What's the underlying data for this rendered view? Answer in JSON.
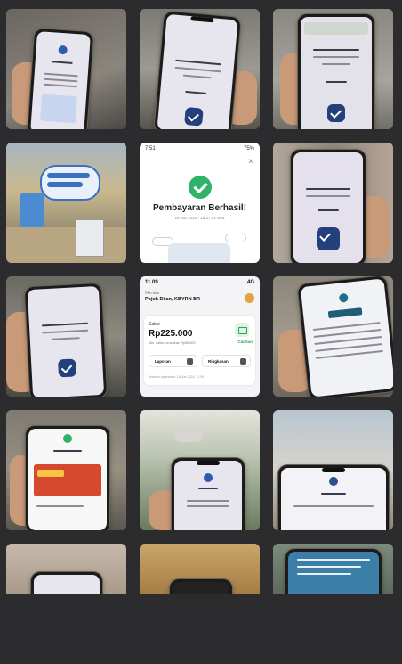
{
  "gallery": {
    "tiles": [
      {
        "kind": "photo",
        "subject": "phone-payment-app"
      },
      {
        "kind": "photo",
        "subject": "phone-payment-confirm"
      },
      {
        "kind": "photo",
        "subject": "phone-payment-notification"
      },
      {
        "kind": "photo",
        "subject": "event-booth"
      },
      {
        "kind": "screenshot",
        "subject": "payment-success"
      },
      {
        "kind": "photo",
        "subject": "phone-payment-success"
      },
      {
        "kind": "photo",
        "subject": "phone-payment-success"
      },
      {
        "kind": "screenshot",
        "subject": "merchant-balance"
      },
      {
        "kind": "photo",
        "subject": "phone-transaction-detail"
      },
      {
        "kind": "photo",
        "subject": "phone-amount-promo"
      },
      {
        "kind": "photo",
        "subject": "phone-payment-amount"
      },
      {
        "kind": "photo",
        "subject": "phone-payment-success"
      },
      {
        "kind": "photo",
        "subject": "phone-partial"
      },
      {
        "kind": "photo",
        "subject": "phone-partial"
      },
      {
        "kind": "photo",
        "subject": "phone-partial"
      }
    ]
  },
  "success_screen": {
    "status_time": "7:51",
    "status_battery": "75%",
    "title": "Pembayaran Berhasil!",
    "date": "16 Jun 2020 · 15:37:51 WIB"
  },
  "balance_screen": {
    "status_time": "11.09",
    "status_network": "4G",
    "merchant_label": "Pilih toko",
    "merchant_name": "Pojok Dilan, KBYRN BR",
    "saldo_label": "Saldo",
    "saldo_value": "Rp225.000",
    "saldo_min": "Min. saldo pencairan Rp50.000",
    "cairkan_label": "Cairkan",
    "laporan_label": "Laporan",
    "ringkasan_label": "Ringkasan",
    "updated_text": "Terakhir diperbarui: 16 Jun 2020, 11.09"
  },
  "colors": {
    "background": "#2c2c2e",
    "success_green": "#2fb36b",
    "check_blue": "#23407d",
    "cairkan_green": "#27a35a"
  },
  "icons": {
    "success": "check-circle-icon",
    "confirm": "check-badge-icon",
    "close": "close-icon",
    "cairkan": "wallet-icon"
  }
}
